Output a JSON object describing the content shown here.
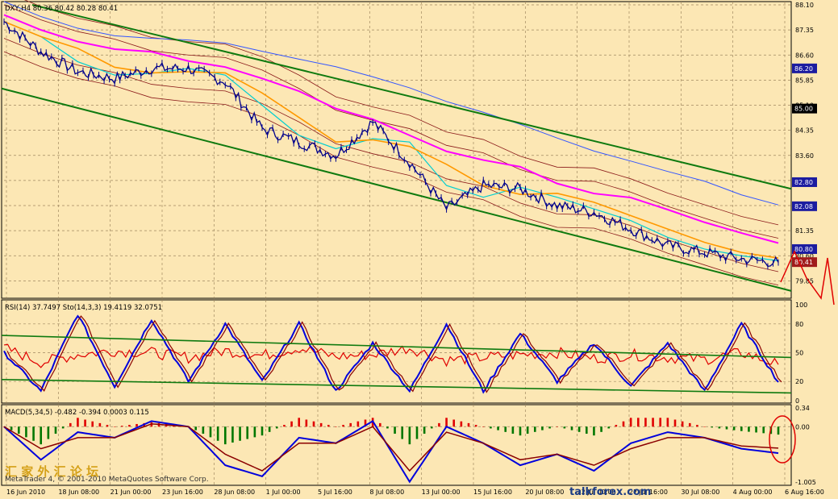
{
  "main": {
    "header": "DXY,H4  80.36 80.42 80.28 80.41",
    "price_ticks": [
      "88.10",
      "87.35",
      "86.60",
      "85.85",
      "85.10",
      "84.35",
      "83.60",
      "82.85",
      "82.10",
      "81.35",
      "80.60",
      "79.85"
    ],
    "price_tags": [
      {
        "text": "86.20",
        "value": 86.2,
        "color": "#1c1ca0"
      },
      {
        "text": "85.00",
        "value": 85.0,
        "color": "#000000"
      },
      {
        "text": "82.80",
        "value": 82.8,
        "color": "#1c1ca0"
      },
      {
        "text": "82.08",
        "value": 82.08,
        "color": "#1c1ca0"
      },
      {
        "text": "80.80",
        "value": 80.8,
        "color": "#1c1ca0"
      },
      {
        "text": "80.41",
        "value": 80.41,
        "color": "#a01c1c"
      }
    ]
  },
  "rsi": {
    "header": "RSI(14) 37.7497  Sto(14,3,3) 19.4119 32.0751",
    "ticks": [
      "100",
      "80",
      "50",
      "20",
      "0"
    ]
  },
  "macd": {
    "header": "MACD(5,34,5) -0.482 -0.394 0.0003 0.115",
    "ticks": [
      "0.34",
      "0.00",
      "-1.005"
    ]
  },
  "time_labels": [
    "16 Jun 2010",
    "18 Jun 08:00",
    "21 Jun 00:00",
    "23 Jun 16:00",
    "28 Jun 08:00",
    "1 Jul 00:00",
    "5 Jul 16:00",
    "8 Jul 08:00",
    "13 Jul 00:00",
    "15 Jul 16:00",
    "20 Jul 08:00",
    "22 Jul 00:00",
    "27 Jul 16:00",
    "30 Jul 08:00",
    "4 Aug 00:00",
    "6 Aug 16:00"
  ],
  "watermark": {
    "copyright": "MetaTrader 4, © 2001-2010 MetaQuotes Software Corp.",
    "site": "talkforex.com",
    "cn": "汇 家 外 汇 论 坛"
  },
  "colors": {
    "background": "#fce7b4",
    "grid": "#a08860",
    "price": "#00008b",
    "ma_fast": "#00ced1",
    "ma_orange": "#ff9900",
    "ma_magenta": "#ff00ff",
    "ma_blue": "#3355ff",
    "bands": "#8b1a1a",
    "channel": "#0f7a0f",
    "rsi": "#e00000",
    "sto_main": "#0000dd",
    "hist_up": "#e00000",
    "hist_down": "#007700",
    "macd_signal": "#8b0000",
    "highlight": "#e00000"
  },
  "chart_data": {
    "type": "line",
    "x": [
      "16 Jun 2010",
      "18 Jun 08:00",
      "21 Jun 00:00",
      "23 Jun 16:00",
      "28 Jun 08:00",
      "1 Jul 00:00",
      "5 Jul 16:00",
      "8 Jul 08:00",
      "13 Jul 00:00",
      "15 Jul 16:00",
      "20 Jul 08:00",
      "22 Jul 00:00",
      "27 Jul 16:00",
      "30 Jul 08:00",
      "4 Aug 00:00",
      "6 Aug 16:00"
    ],
    "ylim": [
      79.45,
      88.1
    ],
    "series": [
      {
        "values": [
          87.6,
          86.7,
          86.1,
          85.9,
          86.2,
          86.2,
          85.8,
          84.4,
          84.0,
          83.6,
          84.6,
          83.4,
          82.0,
          82.7,
          82.6,
          82.1,
          81.9,
          81.4,
          80.9,
          80.7,
          80.5,
          80.4
        ]
      }
    ],
    "panels": [
      {
        "panel": "RSI/Stochastic",
        "ylim": [
          0,
          100
        ],
        "levels": [
          80,
          50,
          20
        ],
        "rsi": [
          55,
          40,
          48,
          52,
          50,
          45,
          52,
          47,
          55,
          46,
          48,
          55,
          42,
          45,
          48,
          50,
          44,
          48,
          45,
          43,
          50,
          37.7
        ],
        "stoch": [
          50,
          10,
          90,
          15,
          85,
          20,
          80,
          20,
          80,
          10,
          60,
          10,
          80,
          10,
          70,
          20,
          60,
          15,
          60,
          10,
          80,
          19.4
        ]
      },
      {
        "panel": "MACD",
        "ylim": [
          -1.005,
          0.34
        ],
        "macd": [
          0.0,
          -0.6,
          -0.1,
          -0.2,
          0.1,
          0.0,
          -0.7,
          -0.9,
          -0.2,
          -0.3,
          0.1,
          -1.0,
          0.0,
          -0.3,
          -0.7,
          -0.5,
          -0.8,
          -0.3,
          -0.1,
          -0.2,
          -0.4,
          -0.48
        ],
        "signal": [
          0.0,
          -0.4,
          -0.2,
          -0.2,
          0.05,
          0.0,
          -0.5,
          -0.8,
          -0.3,
          -0.3,
          0.0,
          -0.8,
          -0.1,
          -0.3,
          -0.6,
          -0.5,
          -0.7,
          -0.4,
          -0.2,
          -0.2,
          -0.35,
          -0.39
        ]
      }
    ]
  }
}
